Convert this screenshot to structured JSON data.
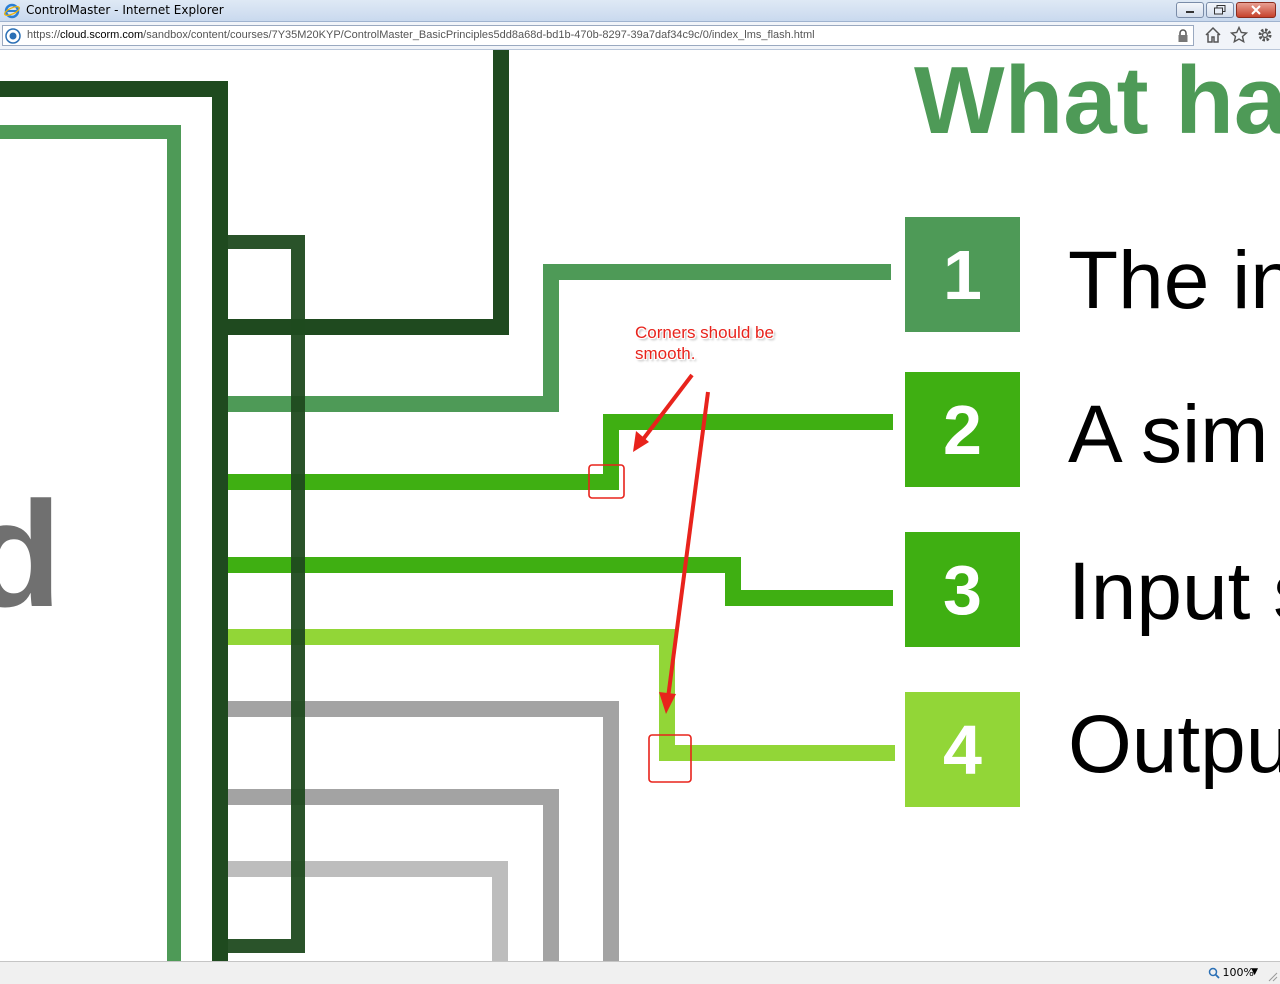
{
  "window": {
    "title": "ControlMaster - Internet Explorer"
  },
  "address_bar": {
    "url_prefix": "https://",
    "url_domain": "cloud.scorm.com",
    "url_path": "/sandbox/content/courses/7Y35M20KYP/ControlMaster_BasicPrinciples5dd8a68d-bd1b-470b-8297-39a7daf34c9c/0/index_lms_flash.html"
  },
  "slide": {
    "title": "What ha",
    "side_letter": "d",
    "items": [
      {
        "number": "1",
        "text": "The in",
        "color": "#4e9a57"
      },
      {
        "number": "2",
        "text": "A sim",
        "color": "#3faf12"
      },
      {
        "number": "3",
        "text": "Input s",
        "color": "#3faf12"
      },
      {
        "number": "4",
        "text": "Outpu",
        "color": "#92d637"
      }
    ]
  },
  "annotation": {
    "text_line1": "Corners should be",
    "text_line2": "smooth."
  },
  "status_bar": {
    "zoom": "100%"
  },
  "colors": {
    "dark_green": "#1f4a1f",
    "mid_green": "#4e9a57",
    "bright_green": "#3faf12",
    "light_green": "#92d637",
    "annotation_red": "#e8231c"
  }
}
